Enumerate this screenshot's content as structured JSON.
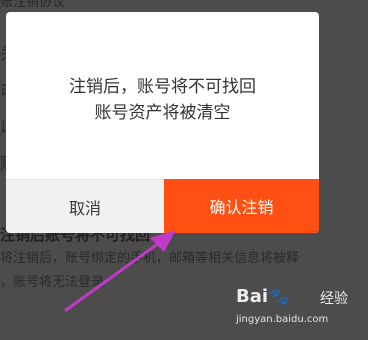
{
  "background": {
    "top_fragment": "账注销协议",
    "side_fragments": [
      "关",
      "可",
      "以",
      "账"
    ],
    "heading": "注销后账号将不可找回",
    "paragraph_line_1": "将注销后，账号绑定的手机，邮箱等相关信息将被释",
    "paragraph_line_2": "，账号将无法登录"
  },
  "dialog": {
    "message_line_1": "注销后，账号将不可找回",
    "message_line_2": "账号资产将被清空",
    "cancel_label": "取消",
    "confirm_label": "确认注销"
  },
  "colors": {
    "confirm_button": "#ff4f12",
    "annotation_arrow": "#c03ac8"
  },
  "watermark": {
    "logo_text_left": "Bai",
    "logo_text_right": "经验",
    "url": "jingyan.baidu.com"
  }
}
